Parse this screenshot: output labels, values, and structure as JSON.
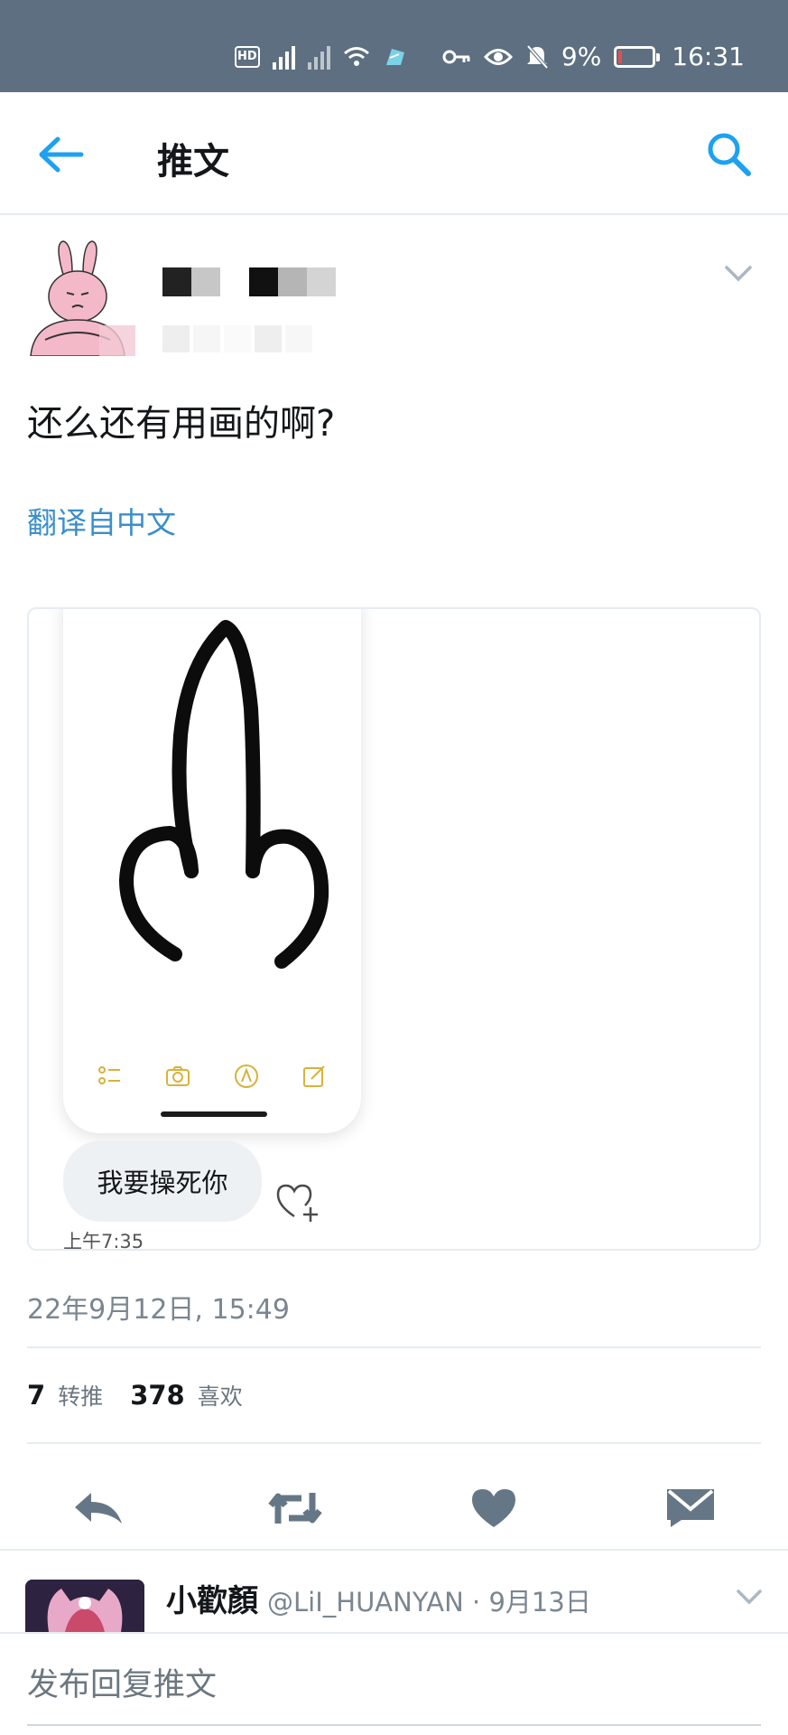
{
  "status_bar": {
    "battery_percent": "9%",
    "battery_level": 0.09,
    "time": "16:31",
    "icons": [
      "hd-icon",
      "signal-5g-icon",
      "signal-icon",
      "wifi-icon",
      "app-notification-icon",
      "key-icon",
      "eye-icon",
      "bell-off-icon",
      "battery-icon"
    ]
  },
  "header": {
    "title": "推文",
    "back_icon": "arrow-left-icon",
    "search_icon": "search-icon"
  },
  "tweet": {
    "text": "还么还有用画的啊?",
    "translate_label": "翻译自中文",
    "media": {
      "chat_message": "我要操死你",
      "chat_time": "上午7:35"
    },
    "timestamp": "22年9月12日, 15:49",
    "retweet_count": "7",
    "retweet_label": "转推",
    "like_count": "378",
    "like_label": "喜欢"
  },
  "reply": {
    "name": "小歡顏",
    "handle": "@LiI_HUANYAN · 9月13日"
  },
  "compose": {
    "placeholder": "发布回复推文"
  },
  "colors": {
    "status_bar": "#5d6f80",
    "accent": "#1da1f2",
    "icon_gray": "#657786"
  }
}
